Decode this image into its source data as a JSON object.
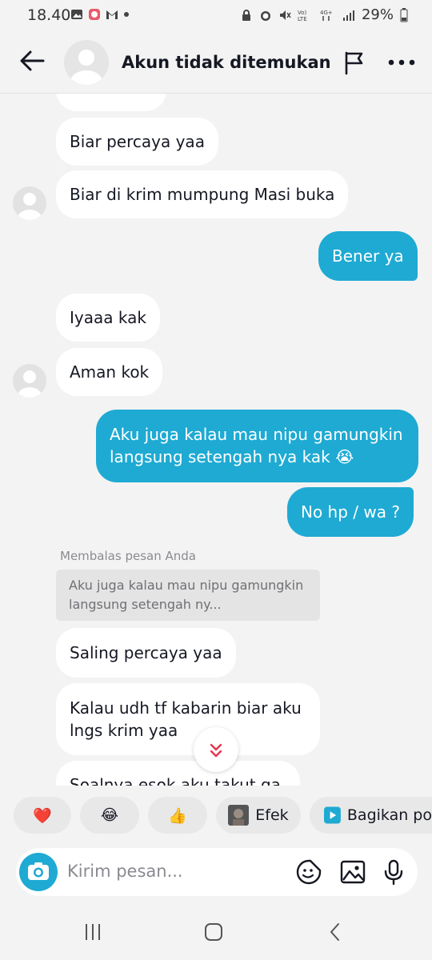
{
  "status_bar": {
    "time": "18.40",
    "battery": "29%"
  },
  "header": {
    "title": "Akun tidak ditemukan"
  },
  "messages": [
    {
      "side": "in",
      "text": "Biar percaya yaa"
    },
    {
      "side": "in",
      "text": "Biar di krim mumpung Masi buka"
    },
    {
      "side": "out",
      "text": "Bener ya"
    },
    {
      "side": "in",
      "text": "Iyaaa kak"
    },
    {
      "side": "in",
      "text": "Aman kok"
    },
    {
      "side": "out",
      "text": "Aku juga kalau mau nipu gamungkin langsung setengah nya kak 😭"
    },
    {
      "side": "out",
      "text": "No hp / wa ?"
    },
    {
      "side": "in",
      "text": "Saling percaya yaa"
    },
    {
      "side": "in",
      "text": "Kalau udh tf kabarin biar aku lngs krim yaa"
    },
    {
      "side": "in",
      "text": "Soalnya esok aku takut ga"
    }
  ],
  "reply": {
    "caption": "Membalas pesan Anda",
    "quote": "Aku juga kalau mau nipu gamungkin langsung setengah ny..."
  },
  "reactions": {
    "heart": "❤️",
    "laugh": "😂",
    "thumbs": "👍",
    "effect_label": "Efek",
    "share_label": "Bagikan po"
  },
  "composer": {
    "placeholder": "Kirim pesan..."
  },
  "colors": {
    "accent": "#1eaad3",
    "background": "#f3f3f3"
  }
}
